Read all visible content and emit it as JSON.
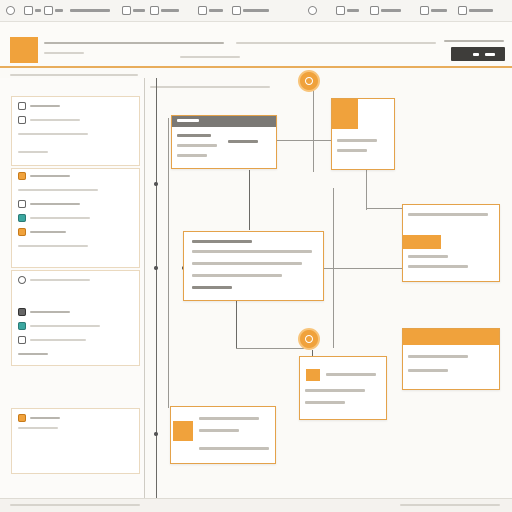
{
  "toolbar": {
    "items": [
      {
        "icon": "app-logo-icon"
      },
      {
        "icon": "dropdown-icon"
      },
      {
        "icon": "square-icon"
      },
      {
        "icon": "menu-icon"
      },
      {
        "icon": "layers-icon"
      },
      {
        "icon": "brush-icon"
      },
      {
        "icon": "play-icon"
      },
      {
        "icon": "grid-icon"
      },
      {
        "icon": "refresh-icon"
      },
      {
        "icon": "link-icon"
      },
      {
        "icon": "settings-icon"
      },
      {
        "icon": "window-icon"
      },
      {
        "icon": "comment-icon"
      }
    ]
  },
  "header": {
    "action_button_labels": [
      "",
      ""
    ]
  },
  "sidebar": {
    "items": [
      {
        "icon": "doc-icon",
        "color": "#888888"
      },
      {
        "icon": "file-icon",
        "color": "#888888"
      },
      {
        "icon": "orange-square-icon",
        "color": "#f0a23c"
      },
      {
        "icon": "folder-icon",
        "color": "#888888"
      },
      {
        "icon": "teal-square-icon",
        "color": "#3ba7a0"
      },
      {
        "icon": "orange-square-icon",
        "color": "#f0a23c"
      },
      {
        "icon": "dark-square-icon",
        "color": "#666666"
      },
      {
        "icon": "circle-icon",
        "color": "#888888"
      },
      {
        "icon": "dark-square-icon",
        "color": "#666666"
      },
      {
        "icon": "teal-square-icon",
        "color": "#3ba7a0"
      },
      {
        "icon": "grid-icon",
        "color": "#888888"
      },
      {
        "icon": "orange-square-icon",
        "color": "#f0a23c"
      }
    ]
  },
  "colors": {
    "accent": "#f0a23c",
    "accent_light": "#f8c47a",
    "dark": "#3e3d3a",
    "connector": "#6b6a66",
    "background": "#fbfaf7"
  }
}
